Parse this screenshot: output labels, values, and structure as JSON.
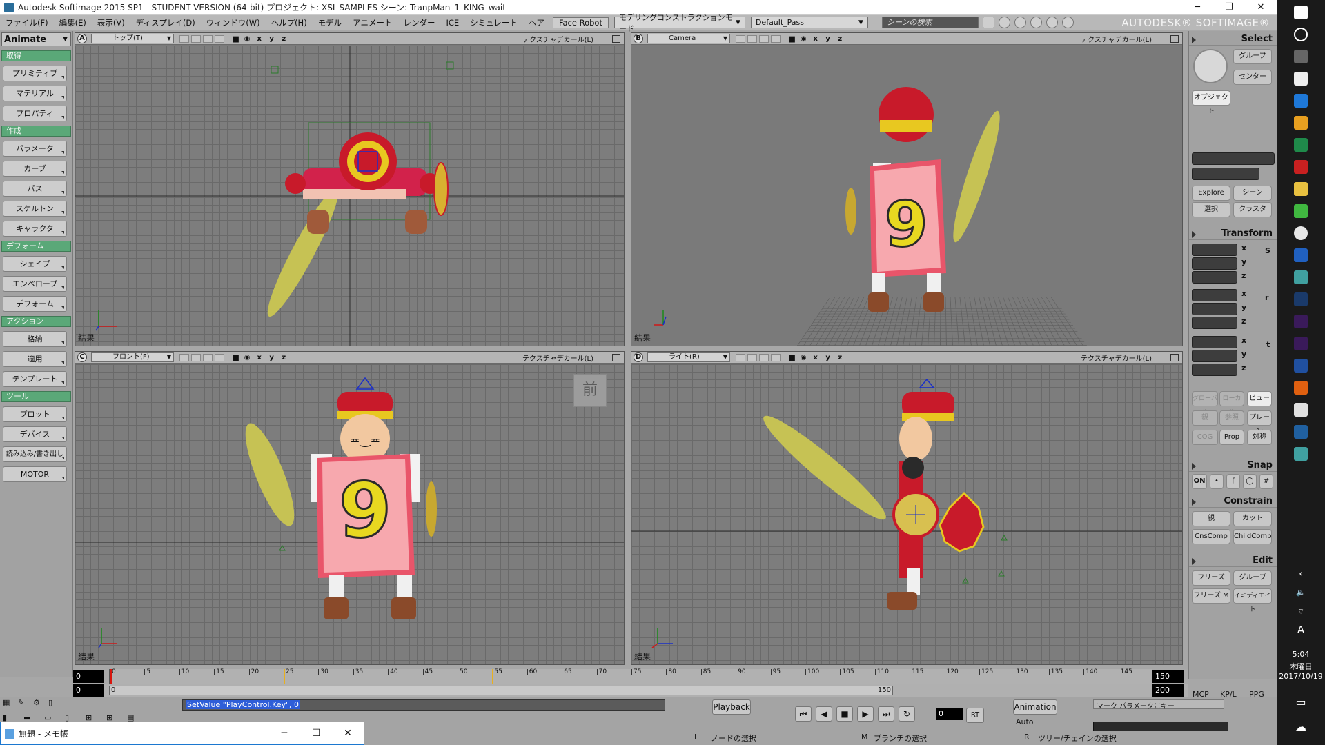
{
  "window": {
    "title": "Autodesk Softimage 2015 SP1 - STUDENT VERSION (64-bit)  プロジェクト: XSI_SAMPLES  シーン: TranpMan_1_KING_wait",
    "controls": [
      "─",
      "❐",
      "✕"
    ]
  },
  "menu": {
    "items": [
      "ファイル(F)",
      "編集(E)",
      "表示(V)",
      "ディスプレイ(D)",
      "ウィンドウ(W)",
      "ヘルプ(H)",
      "モデル",
      "アニメート",
      "レンダー",
      "ICE",
      "シミュレート",
      "ヘア",
      "Face Robot"
    ],
    "mode_dropdown": "モデリングコンストラクションモード",
    "pass_dropdown": "Default_Pass",
    "search_placeholder": "シーンの検索",
    "brand": "AUTODESK® SOFTIMAGE®"
  },
  "left_panel": {
    "module": "Animate",
    "sections": [
      {
        "title": "取得",
        "buttons": [
          "プリミティブ",
          "マテリアル",
          "プロパティ"
        ]
      },
      {
        "title": "作成",
        "buttons": [
          "パラメータ",
          "カーブ",
          "パス",
          "スケルトン",
          "キャラクタ"
        ]
      },
      {
        "title": "デフォーム",
        "buttons": [
          "シェイプ",
          "エンベロープ",
          "デフォーム"
        ]
      },
      {
        "title": "アクション",
        "buttons": [
          "格納",
          "適用",
          "テンプレート"
        ]
      },
      {
        "title": "ツール",
        "buttons": [
          "プロット",
          "デバイス",
          "読み込み/書き出し",
          "MOTOR"
        ]
      }
    ]
  },
  "viewports": {
    "a": {
      "letter": "A",
      "view": "トップ(T)",
      "axes": "x y z",
      "display": "テクスチャデカール(L)",
      "result": "結果"
    },
    "b": {
      "letter": "B",
      "view": "Camera",
      "axes": "x y z",
      "display": "テクスチャデカール(L)",
      "result": "結果"
    },
    "c": {
      "letter": "C",
      "view": "フロント(F)",
      "axes": "x y z",
      "display": "テクスチャデカール(L)",
      "result": "結果",
      "badge": "前"
    },
    "d": {
      "letter": "D",
      "view": "ライト(R)",
      "axes": "x y z",
      "display": "テクスチャデカール(L)",
      "result": "結果"
    },
    "card_number": "9"
  },
  "right_panel": {
    "select": {
      "title": "Select",
      "group": "グループ",
      "center": "センター",
      "object": "オブジェクト",
      "explore": "Explore",
      "scene": "シーン",
      "selection": "選択",
      "cluster": "クラスタ"
    },
    "transform": {
      "title": "Transform",
      "axes": [
        "x",
        "y",
        "z"
      ],
      "s": "S",
      "r": "r",
      "t": "t",
      "global": "グローバル",
      "local": "ローカル",
      "view": "ビュー",
      "par": "親",
      "ref": "参照",
      "plane": "プレーン",
      "cog": "COG",
      "prop": "Prop",
      "sym": "対称"
    },
    "snap": {
      "title": "Snap",
      "on": "ON"
    },
    "constrain": {
      "title": "Constrain",
      "par": "親",
      "cut": "カット",
      "cnscomp": "CnsComp",
      "childcomp": "ChildComp"
    },
    "edit": {
      "title": "Edit",
      "freeze": "フリーズ",
      "group": "グループ",
      "freeze_m": "フリーズ M",
      "immed": "イミディエイト"
    }
  },
  "timeline": {
    "start": "0",
    "current": "0",
    "end": "150",
    "end2": "200",
    "range_end": "150",
    "range_start": "0",
    "ticks": [
      "0",
      "5",
      "10",
      "15",
      "20",
      "25",
      "30",
      "35",
      "40",
      "45",
      "50",
      "55",
      "60",
      "65",
      "70",
      "75",
      "80",
      "85",
      "90",
      "95",
      "100",
      "105",
      "110",
      "115",
      "120",
      "125",
      "130",
      "135",
      "140",
      "145"
    ]
  },
  "bottom": {
    "command": "SetValue \"PlayControl.Key\", 0",
    "playback": "Playback",
    "frame": "0",
    "rt": "RT",
    "animation": "Animation",
    "auto": "Auto",
    "mcp": "MCP",
    "kpl": "KP/L",
    "ppg": "PPG",
    "mark_params": "マーク パラメータにキー",
    "status_l": "ノードの選択",
    "status_m": "ブランチの選択",
    "status_r": "ツリー/チェインの選択",
    "L": "L",
    "M": "M",
    "R": "R"
  },
  "notepad": {
    "title": "無題 - メモ帳",
    "controls": [
      "─",
      "☐",
      "✕"
    ]
  },
  "taskbar": {
    "ime": "A",
    "time": "5:04",
    "day": "木曜日",
    "date": "2017/10/19"
  }
}
